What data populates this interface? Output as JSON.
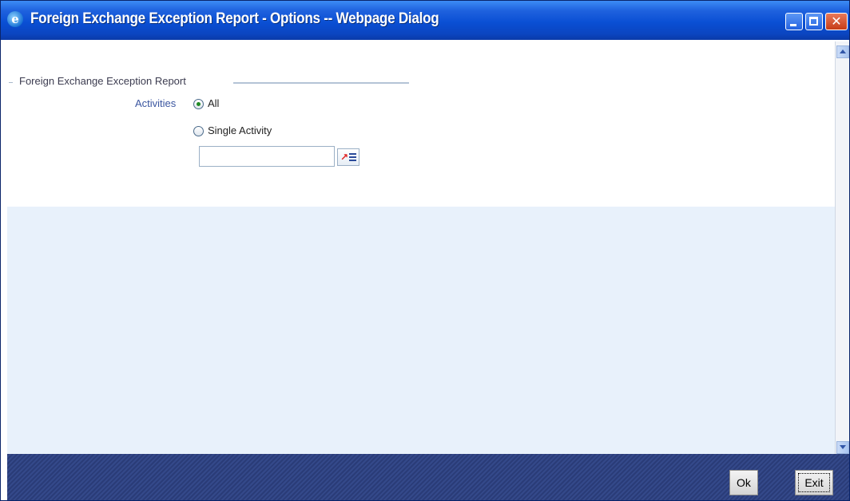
{
  "window": {
    "title": "Foreign Exchange Exception Report - Options -- Webpage Dialog",
    "icon": "ie-icon",
    "controls": [
      "minimize-icon",
      "maximize-icon",
      "close-icon"
    ]
  },
  "form": {
    "section_title": "Foreign Exchange Exception Report",
    "activities_label": "Activities",
    "options": [
      {
        "label": "All",
        "checked": true
      },
      {
        "label": "Single Activity",
        "checked": false
      }
    ],
    "activity_value": "",
    "lov_icon": "list-of-values-icon"
  },
  "footer": {
    "ok_label": "Ok",
    "exit_label": "Exit"
  },
  "colors": {
    "titlebar": "#0a4fd4",
    "content_bg": "#e8f1fb",
    "footer_bg": "#2a3c78",
    "label_blue": "#3b56a0"
  }
}
